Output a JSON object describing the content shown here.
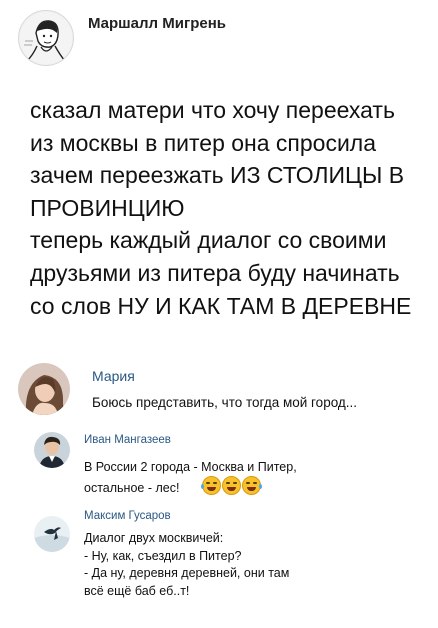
{
  "post": {
    "author": "Маршалл Мигрень",
    "lines": [
      "сказал матери что хочу переехать",
      "из москвы в питер она спросила",
      "зачем переезжать ИЗ СТОЛИЦЫ В",
      "ПРОВИНЦИЮ",
      "теперь каждый диалог со своими",
      "друзьями из питера буду начинать",
      "со слов НУ И КАК ТАМ В ДЕРЕВНЕ"
    ]
  },
  "comments": [
    {
      "name": "Мария",
      "lines": [
        "Боюсь представить, что тогда мой город..."
      ],
      "avatar_icon": "woman-photo-avatar"
    },
    {
      "name": "Иван Мангазеев",
      "lines": [
        "В России 2 города - Москва и Питер,",
        "остальное - лес!"
      ],
      "emoji": [
        "laughing-crying-emoji",
        "laughing-crying-emoji",
        "laughing-crying-emoji"
      ],
      "avatar_icon": "man-photo-avatar"
    },
    {
      "name": "Максим Гусаров",
      "lines": [
        "Диалог двух москвичей:",
        "- Ну, как, съездил в Питер?",
        "- Да ну, деревня деревней, они там",
        "всё ещё баб еб..т!"
      ],
      "avatar_icon": "bird-photo-avatar"
    }
  ],
  "colors": {
    "comment_name": "#2a5885",
    "text": "#111111",
    "background": "#ffffff"
  }
}
